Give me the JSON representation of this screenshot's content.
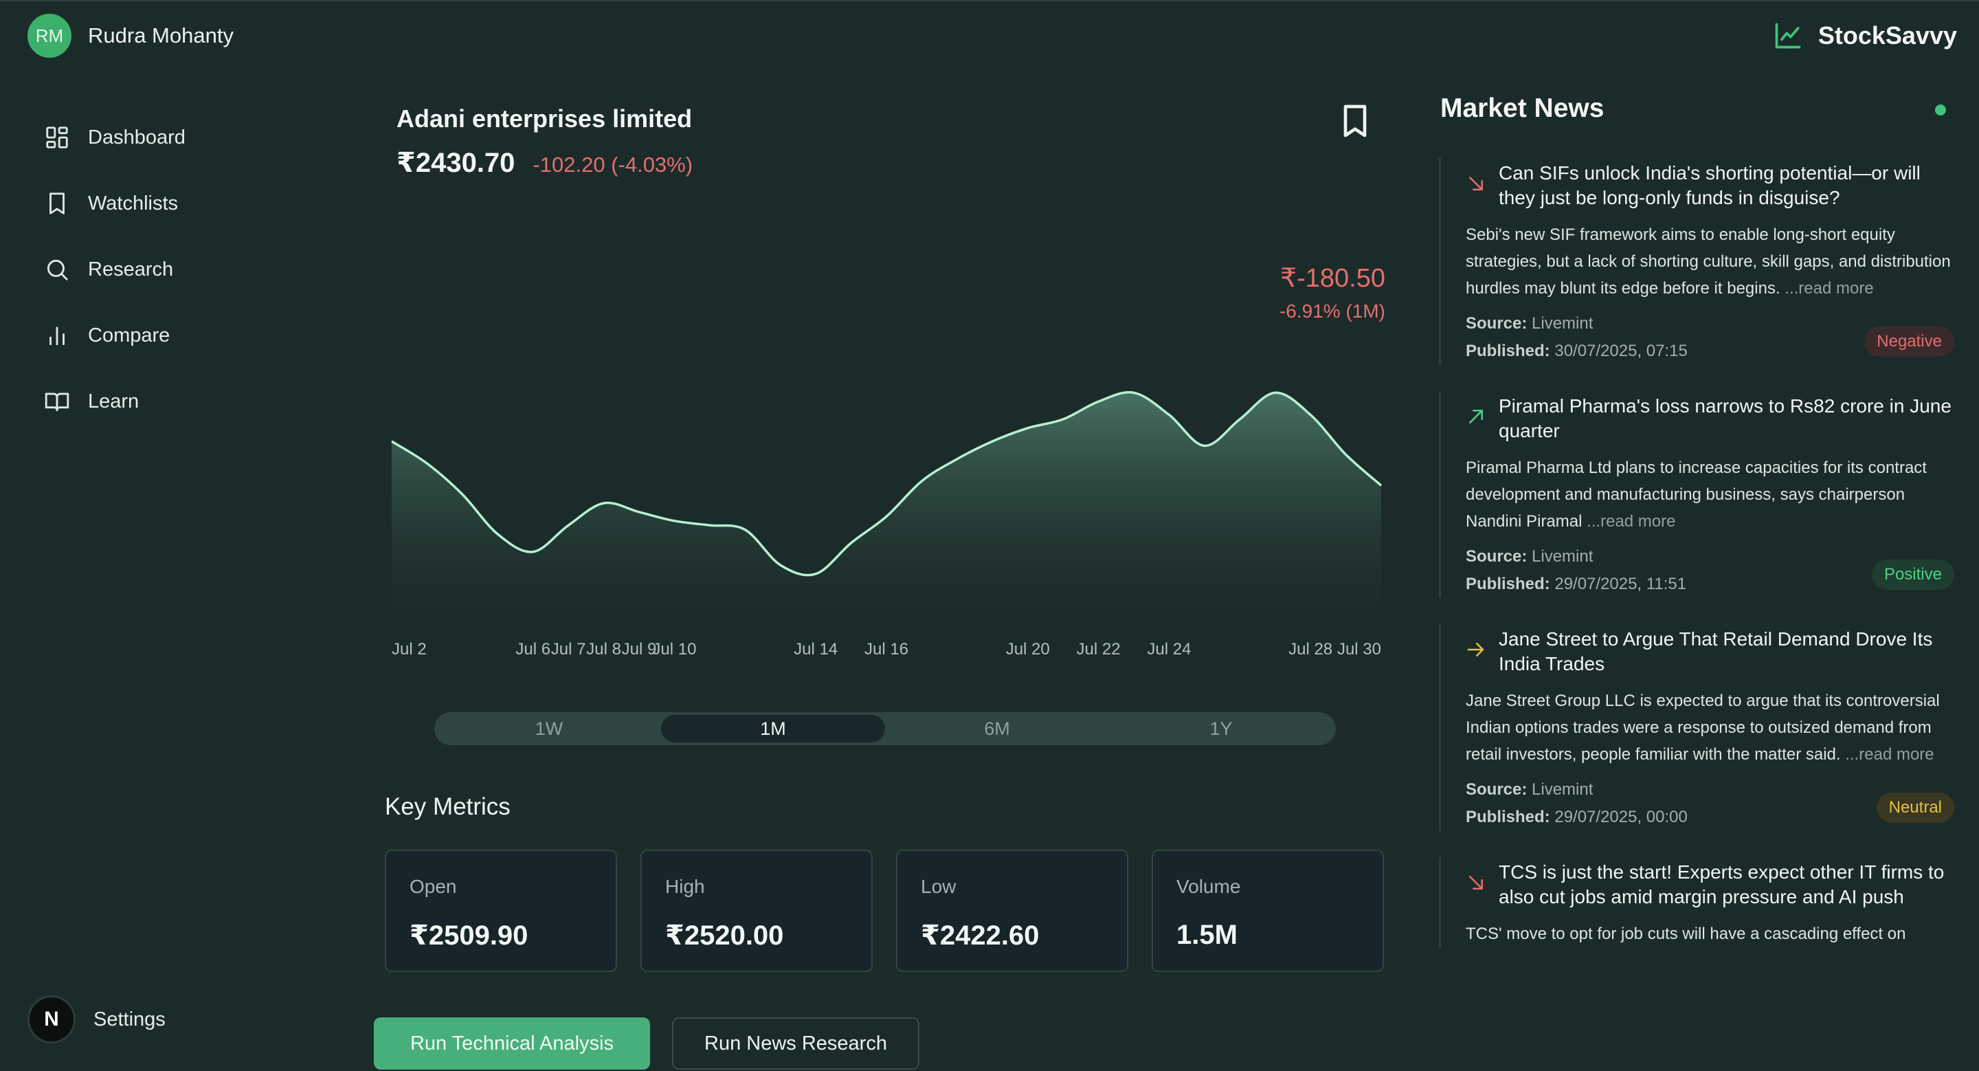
{
  "user": {
    "initials": "RM",
    "name": "Rudra Mohanty"
  },
  "brand": {
    "name": "StockSavvy",
    "icon": "trend-chart-icon",
    "color": "#3fc47d"
  },
  "sidebar": {
    "items": [
      {
        "label": "Dashboard",
        "icon": "dashboard-icon"
      },
      {
        "label": "Watchlists",
        "icon": "bookmark-icon"
      },
      {
        "label": "Research",
        "icon": "search-icon"
      },
      {
        "label": "Compare",
        "icon": "bar-chart-icon"
      },
      {
        "label": "Learn",
        "icon": "book-icon"
      }
    ],
    "settings": {
      "logo": "N",
      "label": "Settings"
    }
  },
  "stock": {
    "name": "Adani enterprises limited",
    "price": "₹2430.70",
    "change": "-102.20",
    "change_pct": "(-4.03%)",
    "period_change": "₹-180.50",
    "period_change_pct": "-6.91% (1M)"
  },
  "chart_data": {
    "type": "area",
    "x": [
      "Jul 2",
      "Jul 3",
      "Jul 4",
      "Jul 5",
      "Jul 6",
      "Jul 7",
      "Jul 8",
      "Jul 9",
      "Jul 10",
      "Jul 11",
      "Jul 12",
      "Jul 13",
      "Jul 14",
      "Jul 15",
      "Jul 16",
      "Jul 17",
      "Jul 18",
      "Jul 19",
      "Jul 20",
      "Jul 21",
      "Jul 22",
      "Jul 23",
      "Jul 24",
      "Jul 25",
      "Jul 26",
      "Jul 27",
      "Jul 28",
      "Jul 29",
      "Jul 30"
    ],
    "values": [
      2611,
      2606,
      2599,
      2590,
      2586,
      2592,
      2597,
      2595,
      2593,
      2592,
      2591,
      2583,
      2581,
      2588,
      2594,
      2602,
      2607,
      2611,
      2614,
      2616,
      2620,
      2622,
      2617,
      2610,
      2616,
      2622,
      2617,
      2608,
      2601
    ],
    "tick_labels": [
      "Jul 2",
      "Jul 6",
      "Jul 7",
      "Jul 8",
      "Jul 9",
      "Jul 10",
      "Jul 14",
      "Jul 16",
      "Jul 20",
      "Jul 22",
      "Jul 24",
      "Jul 28",
      "Jul 30"
    ],
    "color": "#b6f0d2"
  },
  "ranges": {
    "items": [
      "1W",
      "1M",
      "6M",
      "1Y"
    ],
    "active": "1M"
  },
  "metrics": {
    "title": "Key Metrics",
    "items": [
      {
        "label": "Open",
        "value": "₹2509.90"
      },
      {
        "label": "High",
        "value": "₹2520.00"
      },
      {
        "label": "Low",
        "value": "₹2422.60"
      },
      {
        "label": "Volume",
        "value": "1.5M"
      }
    ]
  },
  "actions": {
    "technical": "Run Technical Analysis",
    "news": "Run News Research"
  },
  "news": {
    "title": "Market News",
    "read_more": "...read more",
    "source_label": "Source:",
    "published_label": "Published:",
    "items": [
      {
        "direction": "down",
        "headline": "Can SIFs unlock India's shorting potential—or will they just be long-only funds in disguise?",
        "body": "Sebi's new SIF framework aims to enable long-short equity strategies, but a lack of shorting culture, skill gaps, and distribution hurdles may blunt its edge before it begins.",
        "source": "Livemint",
        "published": "30/07/2025, 07:15",
        "sentiment": "Negative"
      },
      {
        "direction": "up",
        "headline": "Piramal Pharma's loss narrows to Rs82 crore in June quarter",
        "body": "Piramal Pharma Ltd plans to increase capacities for its contract development and manufacturing business, says chairperson Nandini Piramal",
        "source": "Livemint",
        "published": "29/07/2025, 11:51",
        "sentiment": "Positive"
      },
      {
        "direction": "flat",
        "headline": "Jane Street to Argue That Retail Demand Drove Its India Trades",
        "body": "Jane Street Group LLC is expected to argue that its controversial Indian options trades were a response to outsized demand from retail investors, people familiar with the matter said.",
        "source": "Livemint",
        "published": "29/07/2025, 00:00",
        "sentiment": "Neutral"
      },
      {
        "direction": "down",
        "headline": "TCS is just the start! Experts expect other IT firms to also cut jobs amid margin pressure and AI push",
        "body": "TCS' move to opt for job cuts will have a cascading effect on",
        "source": "",
        "published": "",
        "sentiment": ""
      }
    ]
  }
}
